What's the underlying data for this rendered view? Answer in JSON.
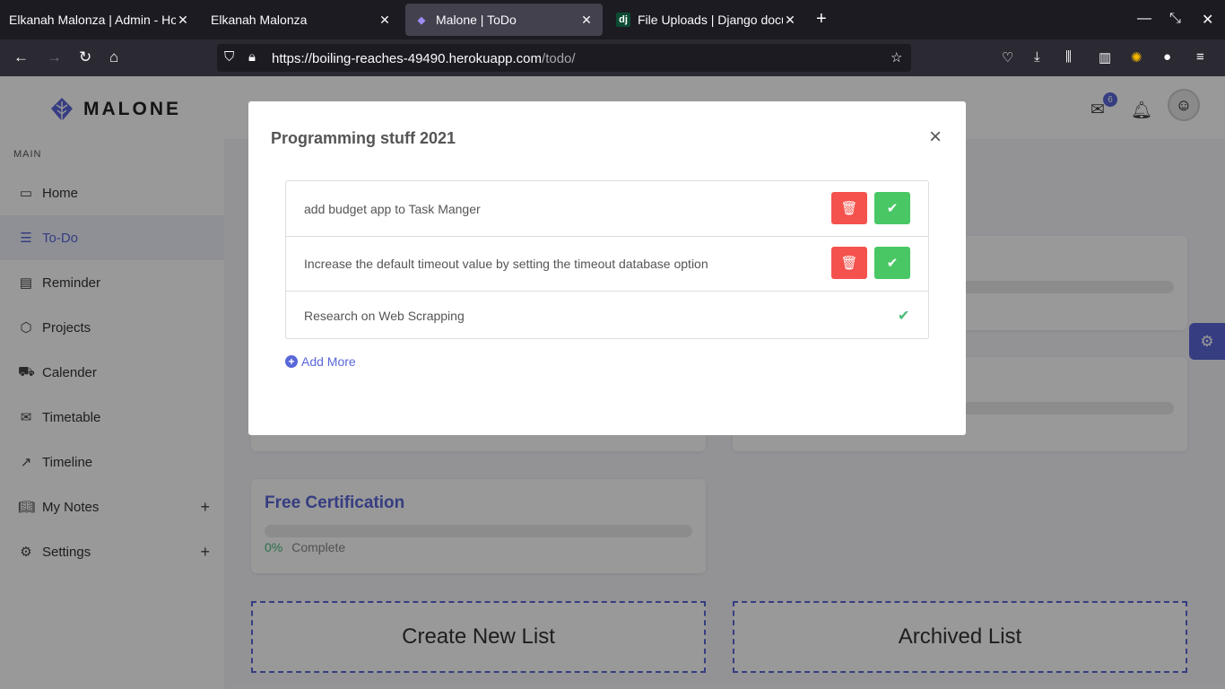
{
  "browser": {
    "tabs": [
      {
        "title": "Elkanah Malonza | Admin - Ho"
      },
      {
        "title": "Elkanah Malonza"
      },
      {
        "title": "Malone | ToDo"
      },
      {
        "title": "File Uploads | Django docu"
      }
    ],
    "tab4_favicon": "dj",
    "url_host": "https://boiling-reaches-49490.herokuapp.com",
    "url_path": "/todo/"
  },
  "app": {
    "brand": "MALONE",
    "section_label": "MAIN",
    "menu": [
      {
        "label": "Home",
        "icon": "monitor-icon"
      },
      {
        "label": "To-Do",
        "icon": "list-icon"
      },
      {
        "label": "Reminder",
        "icon": "archive-icon"
      },
      {
        "label": "Projects",
        "icon": "codepen-icon"
      },
      {
        "label": "Calender",
        "icon": "truck-icon"
      },
      {
        "label": "Timetable",
        "icon": "mail-icon"
      },
      {
        "label": "Timeline",
        "icon": "trending-up-icon"
      },
      {
        "label": "My Notes",
        "icon": "book-icon"
      },
      {
        "label": "Settings",
        "icon": "settings-icon"
      }
    ],
    "mail_badge": "6",
    "cards": [
      {
        "title": "Free Certification",
        "percent": "0%",
        "status": "Complete"
      }
    ],
    "create_label": "Create New List",
    "archived_label": "Archived List"
  },
  "modal": {
    "title": "Programming stuff 2021",
    "close": "×",
    "tasks": [
      {
        "text": "add budget app to Task Manger",
        "done": false
      },
      {
        "text": "Increase the default timeout value by setting the timeout database option",
        "done": false
      },
      {
        "text": "Research on Web Scrapping",
        "done": true
      }
    ],
    "add_more": "Add More"
  },
  "colors": {
    "accent": "#5a67d8",
    "delete": "#f5524d",
    "complete": "#48c764"
  }
}
